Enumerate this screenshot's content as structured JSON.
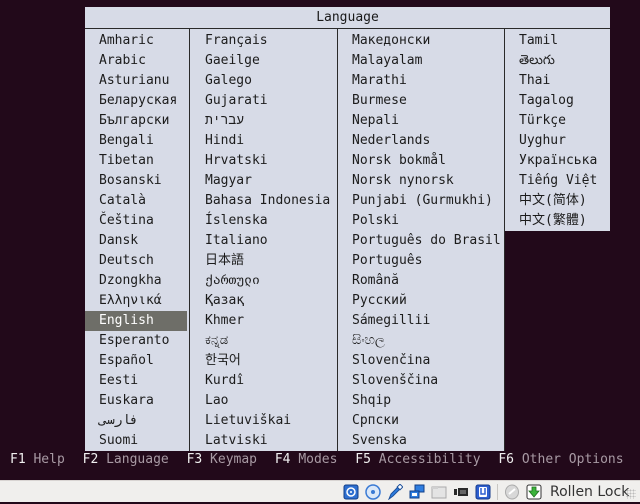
{
  "dialog": {
    "title": "Language",
    "columns": [
      [
        "Amharic",
        "Arabic",
        "Asturianu",
        "Беларуская",
        "Български",
        "Bengali",
        "Tibetan",
        "Bosanski",
        "Català",
        "Čeština",
        "Dansk",
        "Deutsch",
        "Dzongkha",
        "Ελληνικά",
        "English",
        "Esperanto",
        "Español",
        "Eesti",
        "Euskara",
        "فارسی",
        "Suomi"
      ],
      [
        "Français",
        "Gaeilge",
        "Galego",
        "Gujarati",
        "עברית",
        "Hindi",
        "Hrvatski",
        "Magyar",
        "Bahasa Indonesia",
        "Íslenska",
        "Italiano",
        "日本語",
        "ქართული",
        "Қазақ",
        "Khmer",
        "ಕನ್ನಡ",
        "한국어",
        "Kurdî",
        "Lao",
        "Lietuviškai",
        "Latviski"
      ],
      [
        "Македонски",
        "Malayalam",
        "Marathi",
        "Burmese",
        "Nepali",
        "Nederlands",
        "Norsk bokmål",
        "Norsk nynorsk",
        "Punjabi (Gurmukhi)",
        "Polski",
        "Português do Brasil",
        "Português",
        "Română",
        "Русский",
        "Sámegillii",
        "සිංහල",
        "Slovenčina",
        "Slovenščina",
        "Shqip",
        "Српски",
        "Svenska"
      ],
      [
        "Tamil",
        "తెలుగు",
        "Thai",
        "Tagalog",
        "Türkçe",
        "Uyghur",
        "Українська",
        "Tiếng Việt",
        "中文(简体)",
        "中文(繁體)"
      ]
    ],
    "selected": "English"
  },
  "function_keys": [
    {
      "key": "F1",
      "label": "Help"
    },
    {
      "key": "F2",
      "label": "Language"
    },
    {
      "key": "F3",
      "label": "Keymap"
    },
    {
      "key": "F4",
      "label": "Modes"
    },
    {
      "key": "F5",
      "label": "Accessibility"
    },
    {
      "key": "F6",
      "label": "Other Options"
    }
  ],
  "statusbar": {
    "icons": [
      "hard-disk-icon",
      "optical-drive-icon",
      "usb-icon",
      "network-icon",
      "shared-folder-icon",
      "video-capture-icon",
      "cpu-virtualization-icon",
      "mouse-integration-icon",
      "host-key-icon"
    ],
    "host_key_label": "Rollen Lock"
  }
}
